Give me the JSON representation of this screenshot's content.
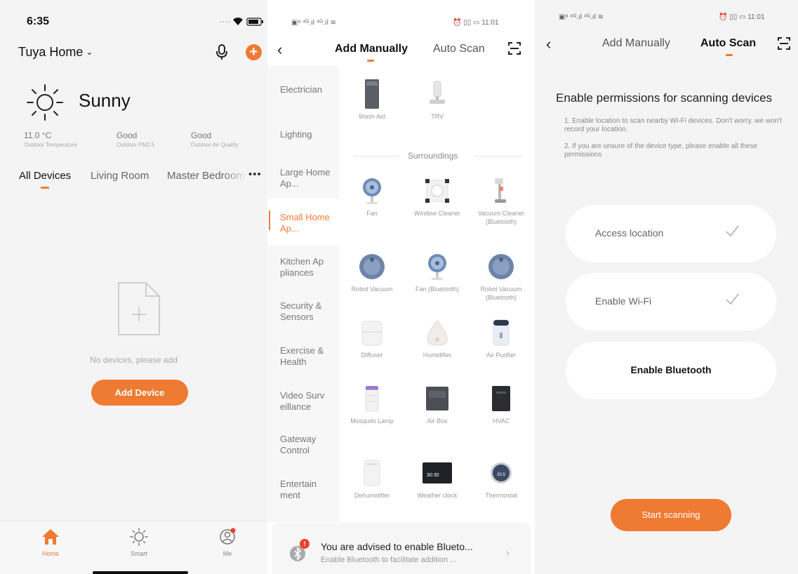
{
  "screen1": {
    "status": {
      "time": "6:35"
    },
    "header": {
      "home_name": "Tuya Home"
    },
    "weather": {
      "condition": "Sunny",
      "stats": [
        {
          "value": "11.0 °C",
          "label": "Outdoor Temperature"
        },
        {
          "value": "Good",
          "label": "Outdoor PM2.5"
        },
        {
          "value": "Good",
          "label": "Outdoor Air Quality"
        }
      ]
    },
    "rooms": [
      "All Devices",
      "Living Room",
      "Master Bedroom"
    ],
    "empty": {
      "text": "No devices, please add",
      "button": "Add Device"
    },
    "tabbar": [
      "Home",
      "Smart",
      "Me"
    ]
  },
  "screen2": {
    "status": {
      "left": "▣ᵃ ⁴ᴳ.ıl ⁴ᴳ.ıl ≋",
      "right": "⏰ ▯▯ ▭ 11:01"
    },
    "header": {
      "tab_manual": "Add Manually",
      "tab_auto": "Auto Scan"
    },
    "categories": [
      "Electrician",
      "Lighting",
      "Large Home Ap...",
      "Small Home Ap...",
      "Kitchen Ap pliances",
      "Security & Sensors",
      "Exercise & Health",
      "Video Surv eillance",
      "Gateway Control",
      "Entertain ment"
    ],
    "top_devices": [
      "Wash Aid",
      "TRV"
    ],
    "section": "Surroundings",
    "devices": [
      "Fan",
      "Window Cleaner",
      "Vacuum Cleaner (Bluetooth)",
      "Robot Vacuum",
      "Fan (Bluetooth)",
      "Robot Vacuum (Bluetooth)",
      "Diffuser",
      "Humidifier",
      "Air Purifier",
      "Mosquito Lamp",
      "Air Box",
      "HVAC",
      "Dehumidifier",
      "Weather clock",
      "Thermostat"
    ],
    "clock_text": "30:30",
    "thermo_text": "30.5",
    "banner": {
      "badge": "!",
      "title": "You are advised to enable Blueto...",
      "subtitle": "Enable Bluetooth to facilitate addition ..."
    }
  },
  "screen3": {
    "status": {
      "left": "▣ᵃ ⁴ᴳ.ıl ⁴ᴳ.ıl ≋",
      "right": "⏰ ▯▯ ▭ 11:01"
    },
    "header": {
      "tab_manual": "Add Manually",
      "tab_auto": "Auto Scan"
    },
    "title": "Enable permissions for scanning devices",
    "notes": [
      "1. Enable location to scan nearby Wi-Fi devices. Don't worry, we won't record your location.",
      "2. If you are unsure of the device type, please enable all these permissions"
    ],
    "permissions": [
      {
        "label": "Access location",
        "done": true
      },
      {
        "label": "Enable Wi-Fi",
        "done": true
      },
      {
        "label": "Enable Bluetooth",
        "done": false
      }
    ],
    "button": "Start scanning"
  },
  "colors": {
    "accent": "#ef7a32",
    "badge": "#e8412c"
  }
}
